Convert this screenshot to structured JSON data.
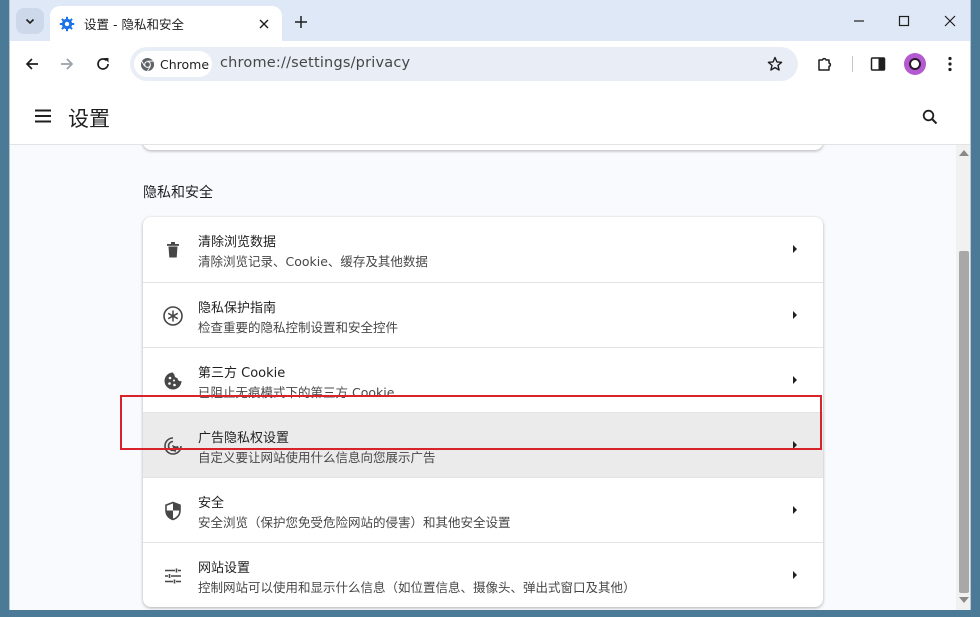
{
  "tab": {
    "title": "设置 - 隐私和安全"
  },
  "toolbar": {
    "chip_label": "Chrome",
    "url": "chrome://settings/privacy"
  },
  "header": {
    "title": "设置"
  },
  "section": {
    "title": "隐私和安全"
  },
  "items": [
    {
      "title": "清除浏览数据",
      "subtitle": "清除浏览记录、Cookie、缓存及其他数据",
      "icon": "trash-icon"
    },
    {
      "title": "隐私保护指南",
      "subtitle": "检查重要的隐私控制设置和安全控件",
      "icon": "privacy-guide-icon"
    },
    {
      "title": "第三方 Cookie",
      "subtitle": "已阻止无痕模式下的第三方 Cookie",
      "icon": "cookie-icon"
    },
    {
      "title": "广告隐私权设置",
      "subtitle": "自定义要让网站使用什么信息向您展示广告",
      "icon": "ad-privacy-icon"
    },
    {
      "title": "安全",
      "subtitle": "安全浏览（保护您免受危险网站的侵害）和其他安全设置",
      "icon": "shield-icon"
    },
    {
      "title": "网站设置",
      "subtitle": "控制网站可以使用和显示什么信息（如位置信息、摄像头、弹出式窗口及其他）",
      "icon": "sliders-icon"
    }
  ],
  "colors": {
    "accent": "#1a73e8",
    "highlight_box": "#d8232a",
    "tabstrip_bg": "#dfe8f6",
    "hover_row_bg": "#ebebeb"
  }
}
